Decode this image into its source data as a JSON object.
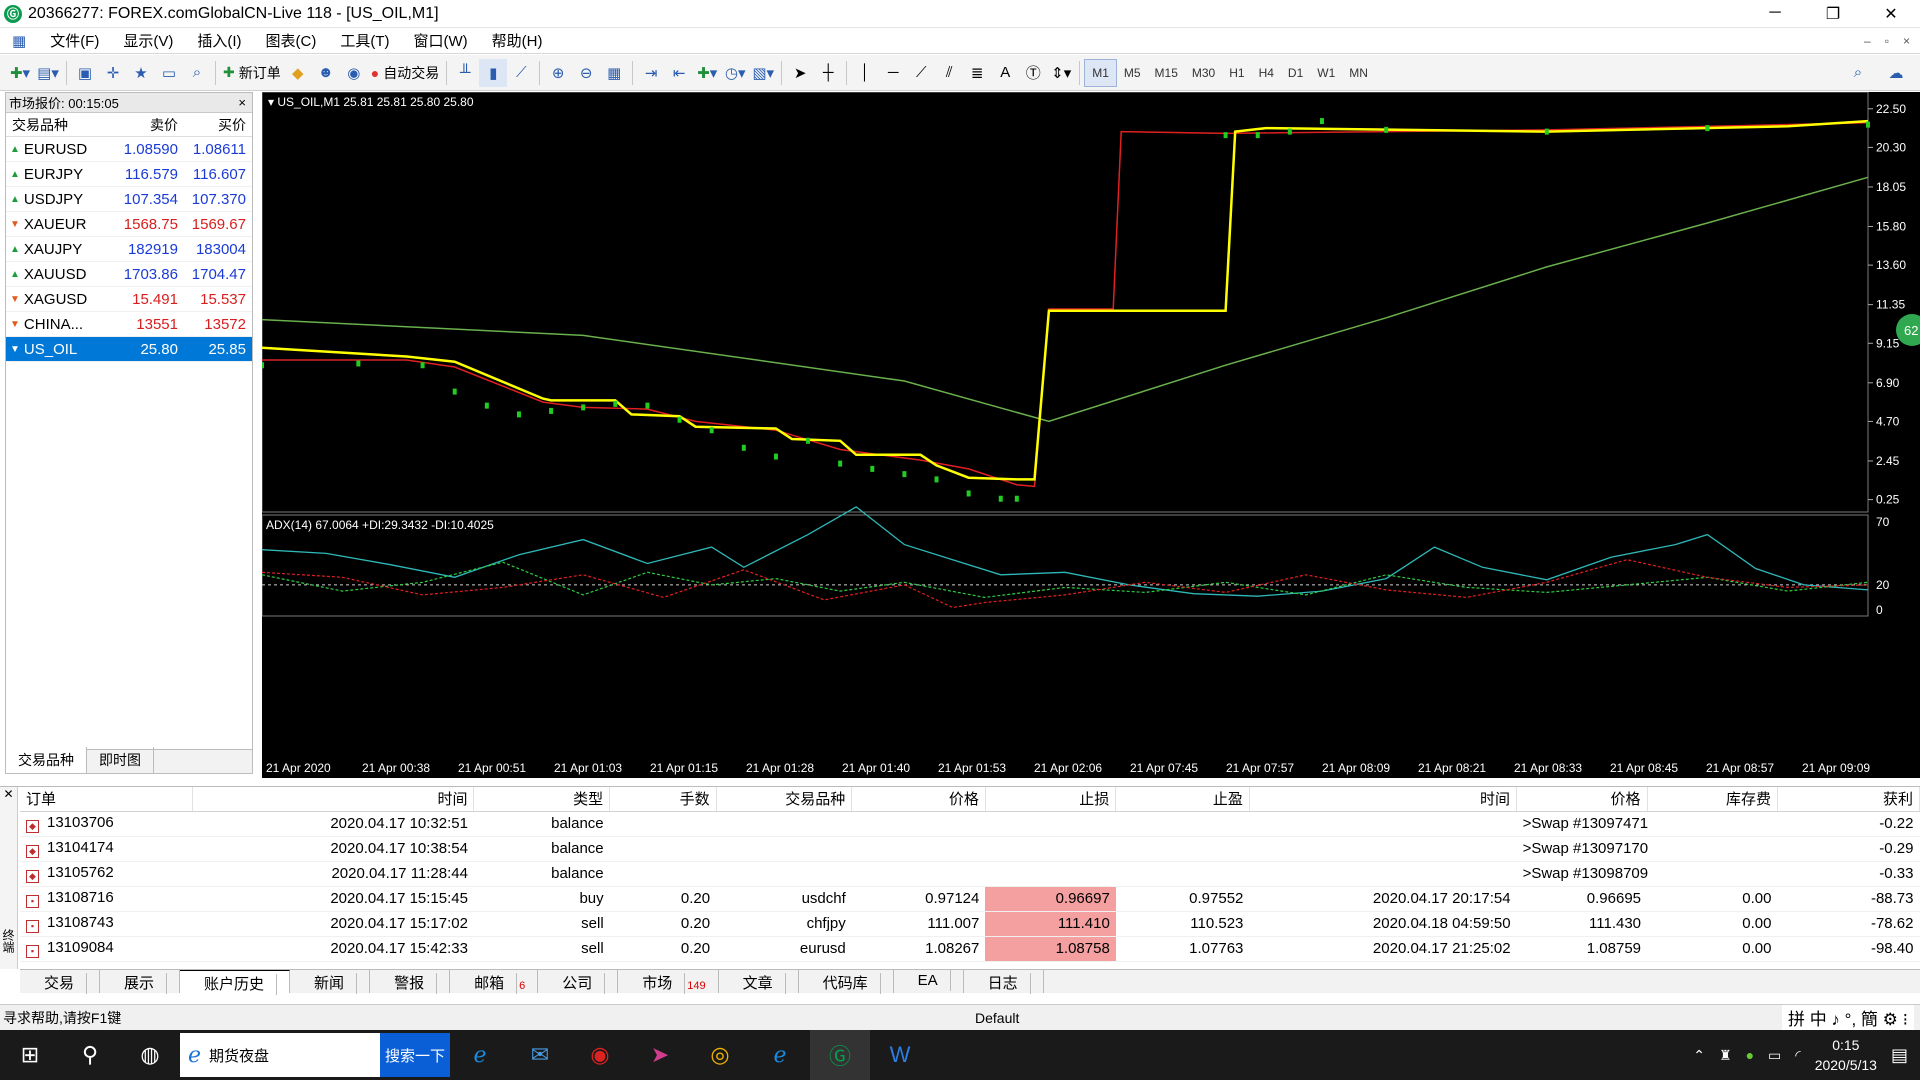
{
  "window": {
    "title": "20366277: FOREX.comGlobalCN-Live 118 - [US_OIL,M1]",
    "app_icon": "Ⓖ",
    "minimize": "─",
    "restore": "❐",
    "close": "✕"
  },
  "menu": {
    "items": [
      "文件(F)",
      "显示(V)",
      "插入(I)",
      "图表(C)",
      "工具(T)",
      "窗口(W)",
      "帮助(H)"
    ],
    "mdi": [
      "–",
      "▫",
      "×"
    ]
  },
  "toolbar": {
    "new_order": "新订单",
    "auto_trade": "自动交易",
    "text_tool": "A",
    "timeframes": [
      "M1",
      "M5",
      "M15",
      "M30",
      "H1",
      "H4",
      "D1",
      "W1",
      "MN"
    ],
    "active_tf": "M1"
  },
  "market_watch": {
    "title": "市场报价: 00:15:05",
    "close": "×",
    "headers": [
      "交易品种",
      "卖价",
      "买价"
    ],
    "rows": [
      {
        "symbol": "EURUSD",
        "bid": "1.08590",
        "ask": "1.08611",
        "dir": "up",
        "color": "#1a3bd6"
      },
      {
        "symbol": "EURJPY",
        "bid": "116.579",
        "ask": "116.607",
        "dir": "up",
        "color": "#1a3bd6"
      },
      {
        "symbol": "USDJPY",
        "bid": "107.354",
        "ask": "107.370",
        "dir": "up",
        "color": "#1a3bd6"
      },
      {
        "symbol": "XAUEUR",
        "bid": "1568.75",
        "ask": "1569.67",
        "dir": "down",
        "color": "#d81e1e"
      },
      {
        "symbol": "XAUJPY",
        "bid": "182919",
        "ask": "183004",
        "dir": "up",
        "color": "#1a3bd6"
      },
      {
        "symbol": "XAUUSD",
        "bid": "1703.86",
        "ask": "1704.47",
        "dir": "up",
        "color": "#1a3bd6"
      },
      {
        "symbol": "XAGUSD",
        "bid": "15.491",
        "ask": "15.537",
        "dir": "down",
        "color": "#d81e1e"
      },
      {
        "symbol": "CHINA...",
        "bid": "13551",
        "ask": "13572",
        "dir": "down",
        "color": "#d81e1e"
      },
      {
        "symbol": "US_OIL",
        "bid": "25.80",
        "ask": "25.85",
        "dir": "down",
        "color": "#ffffff",
        "selected": true
      }
    ],
    "tabs": [
      "交易品种",
      "即时图"
    ]
  },
  "chart": {
    "header": "US_OIL,M1  25.81 25.81 25.80 25.80",
    "adx_label": "ADX(14) 67.0064 +DI:29.3432 -DI:10.4025",
    "side_badge": "62",
    "colors": {
      "price": "#ffff00",
      "ma_red": "#e02020",
      "ma_long": "#6ab04c",
      "adx": "#2fb8b8",
      "di_plus": "#2ecc40",
      "di_minus": "#e02020",
      "candle": "#22cc22"
    }
  },
  "chart_data": {
    "type": "line",
    "price_axis": {
      "ticks": [
        22.5,
        20.3,
        18.05,
        15.8,
        13.6,
        11.35,
        9.15,
        6.9,
        4.7,
        2.45,
        0.25
      ],
      "ylim": [
        0,
        23.0
      ]
    },
    "adx_axis": {
      "ticks": [
        70,
        20,
        0
      ],
      "level": 20,
      "ylim": [
        0,
        70
      ]
    },
    "x_ticks": [
      "21 Apr 2020",
      "21 Apr 00:38",
      "21 Apr 00:51",
      "21 Apr 01:03",
      "21 Apr 01:15",
      "21 Apr 01:28",
      "21 Apr 01:40",
      "21 Apr 01:53",
      "21 Apr 02:06",
      "21 Apr 07:45",
      "21 Apr 07:57",
      "21 Apr 08:09",
      "21 Apr 08:21",
      "21 Apr 08:33",
      "21 Apr 08:45",
      "21 Apr 08:57",
      "21 Apr 09:09"
    ],
    "series": [
      {
        "key": "yellow",
        "x": [
          0,
          0.09,
          0.12,
          0.175,
          0.18,
          0.22,
          0.23,
          0.26,
          0.27,
          0.32,
          0.33,
          0.36,
          0.37,
          0.41,
          0.42,
          0.44,
          0.47,
          0.481,
          0.49,
          0.6,
          0.606,
          0.625,
          0.8,
          0.95,
          1.0
        ],
        "y": [
          8.9,
          8.4,
          8.1,
          6.0,
          5.9,
          5.9,
          5.1,
          5.0,
          4.4,
          4.3,
          3.7,
          3.6,
          2.8,
          2.8,
          2.2,
          1.5,
          1.4,
          1.4,
          11.0,
          11.0,
          21.2,
          21.4,
          21.2,
          21.5,
          21.8
        ]
      },
      {
        "key": "red",
        "x": [
          0,
          0.09,
          0.12,
          0.175,
          0.2,
          0.24,
          0.27,
          0.32,
          0.36,
          0.41,
          0.44,
          0.47,
          0.481,
          0.49,
          0.53,
          0.535,
          0.6,
          0.8,
          1.0
        ],
        "y": [
          8.2,
          8.2,
          7.8,
          5.8,
          5.5,
          5.4,
          4.7,
          4.2,
          3.1,
          2.5,
          2.0,
          1.1,
          1.0,
          11.1,
          11.1,
          21.2,
          21.1,
          21.3,
          21.7
        ]
      },
      {
        "key": "ma_long",
        "x": [
          0,
          0.2,
          0.4,
          0.49,
          0.6,
          0.7,
          0.8,
          0.9,
          1.0
        ],
        "y": [
          10.5,
          9.6,
          7.0,
          4.7,
          7.9,
          10.6,
          13.5,
          16.0,
          18.6
        ]
      },
      {
        "key": "candles",
        "x": [
          0,
          0.06,
          0.1,
          0.12,
          0.14,
          0.16,
          0.18,
          0.2,
          0.22,
          0.24,
          0.26,
          0.28,
          0.3,
          0.32,
          0.34,
          0.36,
          0.38,
          0.4,
          0.42,
          0.44,
          0.46,
          0.47,
          0.6,
          0.62,
          0.64,
          0.66,
          0.7,
          0.8,
          0.9,
          1.0
        ],
        "y": [
          7.9,
          8.0,
          7.9,
          6.4,
          5.6,
          5.1,
          5.3,
          5.5,
          5.7,
          5.6,
          4.8,
          4.2,
          3.2,
          2.7,
          3.6,
          2.3,
          2.0,
          1.7,
          1.4,
          0.6,
          0.3,
          0.3,
          21.0,
          21.0,
          21.2,
          21.8,
          21.3,
          21.2,
          21.4,
          21.6
        ]
      },
      {
        "key": "adx",
        "x": [
          0,
          0.04,
          0.08,
          0.12,
          0.16,
          0.2,
          0.24,
          0.28,
          0.3,
          0.34,
          0.37,
          0.4,
          0.43,
          0.46,
          0.5,
          0.54,
          0.58,
          0.62,
          0.66,
          0.7,
          0.73,
          0.76,
          0.8,
          0.84,
          0.88,
          0.9,
          0.93,
          0.96,
          1.0
        ],
        "y": [
          48,
          45,
          36,
          26,
          44,
          56,
          37,
          50,
          34,
          60,
          82,
          52,
          40,
          28,
          30,
          20,
          13,
          11,
          15,
          25,
          50,
          34,
          24,
          42,
          52,
          60,
          33,
          20,
          16
        ]
      },
      {
        "key": "di_plus",
        "x": [
          0,
          0.05,
          0.1,
          0.15,
          0.2,
          0.24,
          0.28,
          0.32,
          0.36,
          0.4,
          0.45,
          0.5,
          0.55,
          0.6,
          0.65,
          0.7,
          0.75,
          0.8,
          0.85,
          0.9,
          0.95,
          1.0
        ],
        "y": [
          28,
          15,
          22,
          38,
          12,
          30,
          20,
          25,
          15,
          22,
          10,
          18,
          14,
          22,
          12,
          28,
          18,
          14,
          20,
          26,
          15,
          22
        ]
      },
      {
        "key": "di_minus",
        "x": [
          0,
          0.05,
          0.1,
          0.15,
          0.2,
          0.25,
          0.3,
          0.35,
          0.4,
          0.43,
          0.45,
          0.5,
          0.55,
          0.6,
          0.65,
          0.7,
          0.75,
          0.8,
          0.85,
          0.9,
          0.95,
          1.0
        ],
        "y": [
          30,
          26,
          12,
          18,
          28,
          10,
          32,
          8,
          20,
          2,
          6,
          12,
          22,
          14,
          28,
          16,
          10,
          22,
          40,
          26,
          18,
          20
        ]
      }
    ]
  },
  "terminal": {
    "side_label": "终端",
    "headers": [
      "订单",
      "时间",
      "类型",
      "手数",
      "交易品种",
      "价格",
      "止损",
      "止盈",
      "时间",
      "价格",
      "库存费",
      "获利"
    ],
    "rows": [
      {
        "order": "13103706",
        "time": "2020.04.17 10:32:51",
        "type": "balance",
        "lots": "",
        "symbol": "",
        "price": "",
        "sl": "",
        "tp": "",
        "ctime": "",
        "cprice": ">Swap #13097471",
        "swap": "",
        "profit": "-0.22",
        "icon": "◆"
      },
      {
        "order": "13104174",
        "time": "2020.04.17 10:38:54",
        "type": "balance",
        "lots": "",
        "symbol": "",
        "price": "",
        "sl": "",
        "tp": "",
        "ctime": "",
        "cprice": ">Swap #13097170",
        "swap": "",
        "profit": "-0.29",
        "icon": "◆"
      },
      {
        "order": "13105762",
        "time": "2020.04.17 11:28:44",
        "type": "balance",
        "lots": "",
        "symbol": "",
        "price": "",
        "sl": "",
        "tp": "",
        "ctime": "",
        "cprice": ">Swap #13098709",
        "swap": "",
        "profit": "-0.33",
        "icon": "◆"
      },
      {
        "order": "13108716",
        "time": "2020.04.17 15:15:45",
        "type": "buy",
        "lots": "0.20",
        "symbol": "usdchf",
        "price": "0.97124",
        "sl": "0.96697",
        "tp": "0.97552",
        "ctime": "2020.04.17 20:17:54",
        "cprice": "0.96695",
        "swap": "0.00",
        "profit": "-88.73",
        "icon": "▪"
      },
      {
        "order": "13108743",
        "time": "2020.04.17 15:17:02",
        "type": "sell",
        "lots": "0.20",
        "symbol": "chfjpy",
        "price": "111.007",
        "sl": "111.410",
        "tp": "110.523",
        "ctime": "2020.04.18 04:59:50",
        "cprice": "111.430",
        "swap": "0.00",
        "profit": "-78.62",
        "icon": "▪"
      },
      {
        "order": "13109084",
        "time": "2020.04.17 15:42:33",
        "type": "sell",
        "lots": "0.20",
        "symbol": "eurusd",
        "price": "1.08267",
        "sl": "1.08758",
        "tp": "1.07763",
        "ctime": "2020.04.17 21:25:02",
        "cprice": "1.08759",
        "swap": "0.00",
        "profit": "-98.40",
        "icon": "▪"
      }
    ],
    "tabs": [
      {
        "label": "交易"
      },
      {
        "label": "展示"
      },
      {
        "label": "账户历史",
        "active": true
      },
      {
        "label": "新闻"
      },
      {
        "label": "警报"
      },
      {
        "label": "邮箱",
        "badge": "6"
      },
      {
        "label": "公司"
      },
      {
        "label": "市场",
        "badge": "149"
      },
      {
        "label": "文章"
      },
      {
        "label": "代码库"
      },
      {
        "label": "EA"
      },
      {
        "label": "日志"
      }
    ]
  },
  "status": {
    "help": "寻求帮助,请按F1键",
    "profile": "Default",
    "ime": "拼 中 ♪ °, 簡 ⚙ ⁝"
  },
  "taskbar": {
    "ie_label": "期货夜盘",
    "search_btn": "搜索一下",
    "time": "0:15",
    "date": "2020/5/13"
  }
}
